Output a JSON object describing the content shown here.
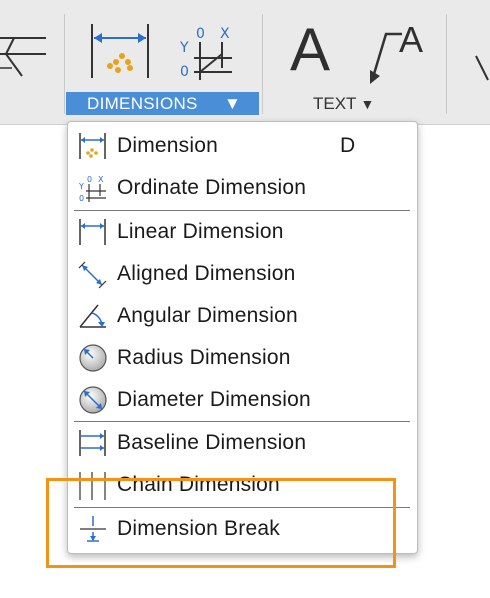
{
  "ribbon": {
    "dimensions_group_label": "DIMENSIONS",
    "dimensions_group_arrow": "▼",
    "text_group_label": "TEXT",
    "text_group_arrow": "▼",
    "text_big_glyph": "A",
    "text_leader_glyph": "A",
    "group_button_color": "#4a8ed8"
  },
  "menu": {
    "items": [
      {
        "label": "Dimension",
        "shortcut": "D",
        "icon": "dimension-icon"
      },
      {
        "label": "Ordinate Dimension",
        "icon": "ordinate-dimension-icon"
      },
      {
        "label": "Linear Dimension",
        "icon": "linear-dimension-icon"
      },
      {
        "label": "Aligned Dimension",
        "icon": "aligned-dimension-icon"
      },
      {
        "label": "Angular Dimension",
        "icon": "angular-dimension-icon"
      },
      {
        "label": "Radius Dimension",
        "icon": "radius-dimension-icon"
      },
      {
        "label": "Diameter Dimension",
        "icon": "diameter-dimension-icon"
      },
      {
        "label": "Baseline Dimension",
        "icon": "baseline-dimension-icon"
      },
      {
        "label": "Chain Dimension",
        "icon": "chain-dimension-icon"
      },
      {
        "label": "Dimension Break",
        "icon": "dimension-break-icon"
      }
    ]
  },
  "highlight_color": "#f39315"
}
